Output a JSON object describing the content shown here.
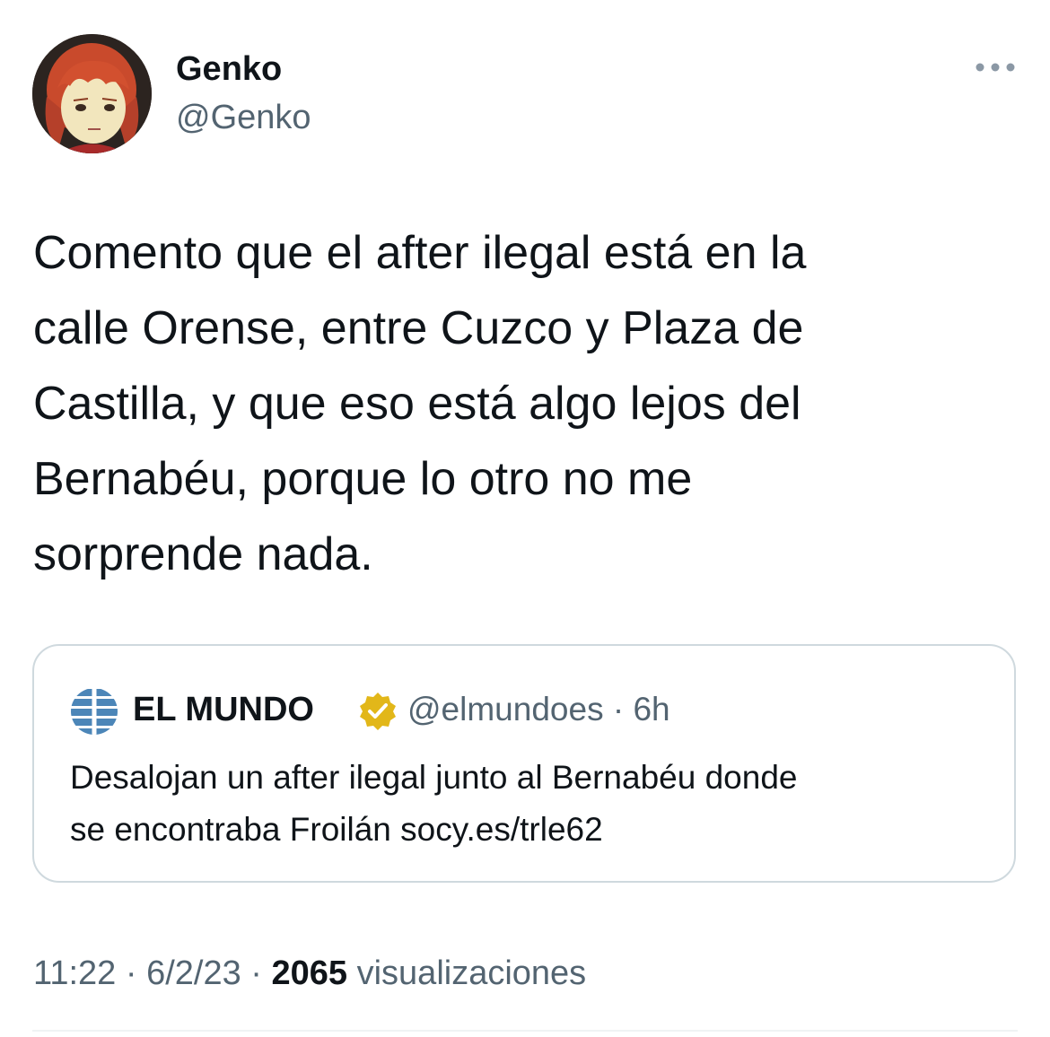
{
  "author": {
    "name": "Genko",
    "handle": "@Genko"
  },
  "tweet": {
    "text": "Comento que el after ilegal está en la\ncalle Orense, entre Cuzco y Plaza de\nCastilla, y que eso está algo lejos del\nBernabéu, porque lo otro no me\nsorprende nada."
  },
  "quoted": {
    "name": "EL MUNDO",
    "handle": "@elmundoes",
    "separator": "·",
    "age": "6h",
    "text": "Desalojan un after ilegal junto al Bernabéu donde\nse encontraba Froilán socy.es/trle62",
    "verified_color": "#e2b719"
  },
  "footer": {
    "time": "11:22",
    "date": "6/2/23",
    "separator": "·",
    "views_count": "2065",
    "views_label": "visualizaciones"
  },
  "icons": {
    "more": "more-horizontal-icon",
    "verified": "verified-badge-icon",
    "logo": "el-mundo-globe-icon"
  },
  "colors": {
    "text": "#0f1419",
    "secondary": "#536471",
    "border": "#cfd9de"
  }
}
